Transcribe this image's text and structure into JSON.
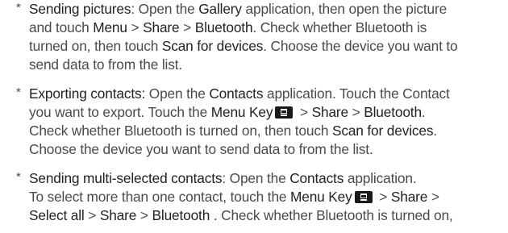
{
  "bullet_symbol": "*",
  "icons": {
    "menu_key": "menu-key-icon"
  },
  "items": [
    {
      "lines": [
        [
          {
            "t": "Sending pictures",
            "h": true
          },
          {
            "t": ": Open the "
          },
          {
            "t": "Gallery",
            "h": true
          },
          {
            "t": " application, then open the picture"
          }
        ],
        [
          {
            "t": "and touch "
          },
          {
            "t": "Menu",
            "h": true
          },
          {
            "t": " > "
          },
          {
            "t": "Share",
            "h": true
          },
          {
            "t": " > "
          },
          {
            "t": "Bluetooth",
            "h": true
          },
          {
            "t": ". Check whether Bluetooth is"
          }
        ],
        [
          {
            "t": "turned on, then touch "
          },
          {
            "t": "Scan for devices",
            "h": true
          },
          {
            "t": ". Choose the device you want to"
          }
        ],
        [
          {
            "t": "send data to from the list."
          }
        ]
      ]
    },
    {
      "lines": [
        [
          {
            "t": "Exporting contacts:",
            "h": true
          },
          {
            "t": " Open the "
          },
          {
            "t": "Contacts",
            "h": true
          },
          {
            "t": " application. Touch the Contact"
          }
        ],
        [
          {
            "t": "you want to export. Touch the "
          },
          {
            "t": "Menu Key",
            "h": true
          },
          {
            "icon": "menu-key-icon"
          },
          {
            "t": " > "
          },
          {
            "t": "Share",
            "h": true
          },
          {
            "t": " > "
          },
          {
            "t": "Bluetooth",
            "h": true
          },
          {
            "t": "."
          }
        ],
        [
          {
            "t": "Check whether Bluetooth is turned on, then touch "
          },
          {
            "t": "Scan for devices",
            "h": true
          },
          {
            "t": "."
          }
        ],
        [
          {
            "t": "Choose the device you want to send data to from the list."
          }
        ]
      ]
    },
    {
      "lines": [
        [
          {
            "t": "Sending multi-selected contacts",
            "h": true
          },
          {
            "t": ": Open the "
          },
          {
            "t": "Contacts",
            "h": true
          },
          {
            "t": " application."
          }
        ],
        [
          {
            "t": "To select more than one contact, touch the "
          },
          {
            "t": "Menu Key",
            "h": true
          },
          {
            "icon": "menu-key-icon"
          },
          {
            "t": " > "
          },
          {
            "t": "Share",
            "h": true
          },
          {
            "t": " >"
          }
        ],
        [
          {
            "t": "Select all",
            "h": true
          },
          {
            "t": " > "
          },
          {
            "t": "Share",
            "h": true
          },
          {
            "t": " > "
          },
          {
            "t": "Bluetooth",
            "h": true
          },
          {
            "t": " . Check whether Bluetooth is turned on,"
          }
        ]
      ]
    }
  ]
}
